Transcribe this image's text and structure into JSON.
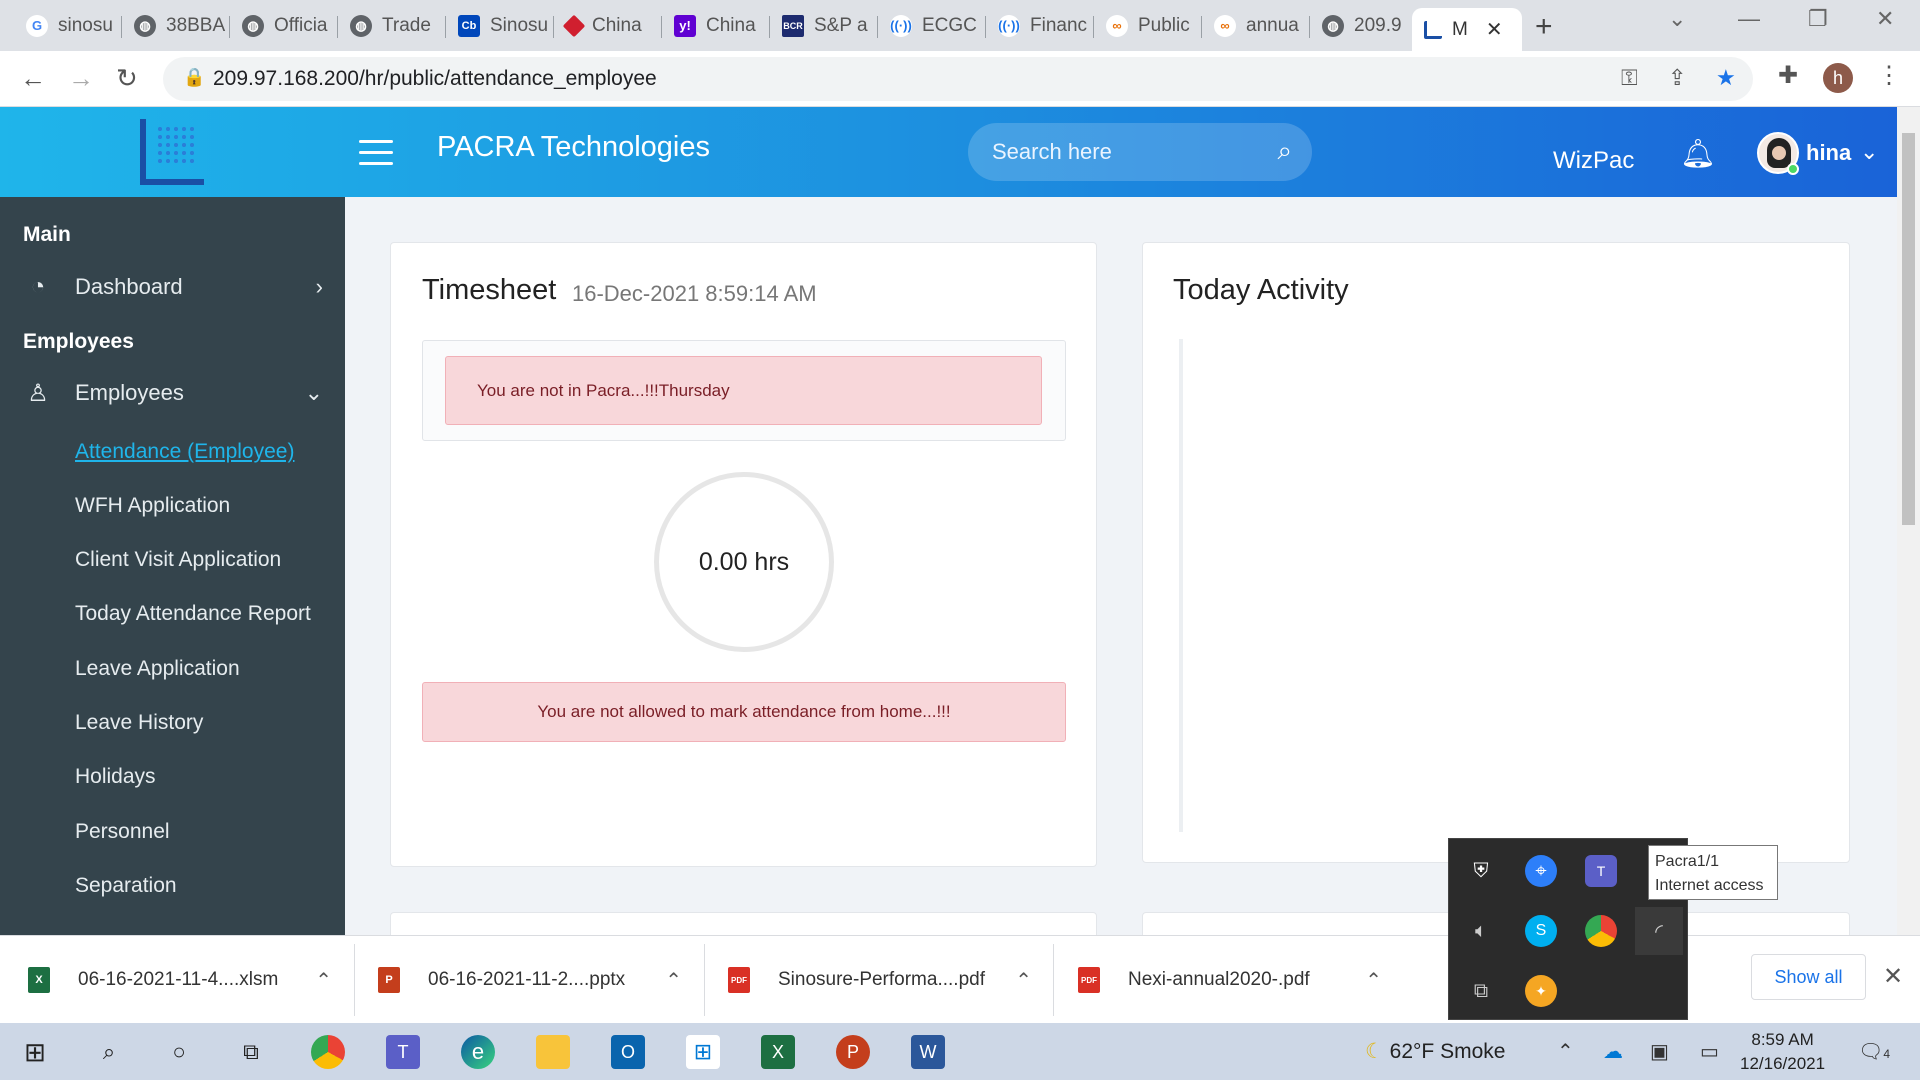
{
  "browser": {
    "tabs": [
      {
        "label": "sinosu",
        "icon": "google-icon",
        "color": "#4285f4"
      },
      {
        "label": "38BBA",
        "icon": "globe-icon",
        "color": "#5f6368"
      },
      {
        "label": "Officia",
        "icon": "globe-icon",
        "color": "#5f6368"
      },
      {
        "label": "Trade",
        "icon": "globe-icon",
        "color": "#5f6368"
      },
      {
        "label": "Sinosu",
        "icon": "cb-icon",
        "color": "#0047bb"
      },
      {
        "label": "China",
        "icon": "diamond-icon",
        "color": "#d01f2f"
      },
      {
        "label": "China",
        "icon": "yahoo-icon",
        "color": "#6001d2"
      },
      {
        "label": "S&P a",
        "icon": "bcr-icon",
        "color": "#1d2b6f"
      },
      {
        "label": "ECGC",
        "icon": "signal-icon",
        "color": "#1a73e8"
      },
      {
        "label": "Financ",
        "icon": "signal-icon",
        "color": "#1a73e8"
      },
      {
        "label": "Public",
        "icon": "rings-icon",
        "color": "#e8710a"
      },
      {
        "label": "annua",
        "icon": "rings-icon",
        "color": "#e8710a"
      },
      {
        "label": "209.9",
        "icon": "globe-icon",
        "color": "#5f6368"
      },
      {
        "label": "M",
        "icon": "pacra-icon",
        "color": "#1a4fa5"
      }
    ],
    "url": "209.97.168.200/hr/public/attendance_employee",
    "profile_initial": "h"
  },
  "header": {
    "brand": "PACRA Technologies",
    "search_placeholder": "Search here",
    "wizpac": "WizPac",
    "user_name": "hina"
  },
  "sidebar": {
    "section_main": "Main",
    "dashboard": "Dashboard",
    "section_employees": "Employees",
    "employees": "Employees",
    "sub_items": [
      "Attendance (Employee)",
      "WFH Application",
      "Client Visit Application",
      "Today Attendance Report",
      "Leave Application",
      "Leave History",
      "Holidays",
      "Personnel",
      "Separation"
    ]
  },
  "timesheet": {
    "title": "Timesheet",
    "datetime": "16-Dec-2021 8:59:14 AM",
    "alert_location": "You are not in Pacra...!!!Thursday",
    "hours": "0.00 hrs",
    "alert_home": "You are not allowed to mark attendance from home...!!!"
  },
  "activity": {
    "title": "Today Activity"
  },
  "downloads": {
    "items": [
      {
        "name": "06-16-2021-11-4....xlsm",
        "type": "xlsm",
        "color": "#1d6f42"
      },
      {
        "name": "06-16-2021-11-2....pptx",
        "type": "pptx",
        "color": "#c43e1c"
      },
      {
        "name": "Sinosure-Performa....pdf",
        "type": "pdf",
        "color": "#d93025"
      },
      {
        "name": "Nexi-annual2020-.pdf",
        "type": "pdf",
        "color": "#d93025"
      }
    ],
    "show_all": "Show all"
  },
  "tray": {
    "tooltip_line1": "Pacra1/1",
    "tooltip_line2": "Internet access"
  },
  "taskbar": {
    "weather": "62°F  Smoke",
    "time": "8:59 AM",
    "date": "12/16/2021",
    "notification_count": "4"
  }
}
